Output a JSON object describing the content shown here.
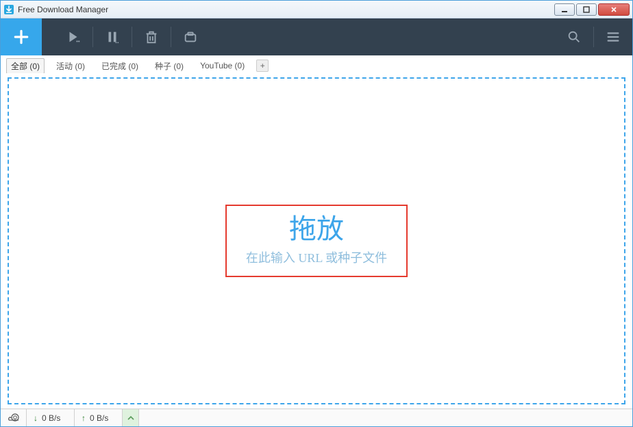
{
  "window": {
    "title": "Free Download Manager"
  },
  "tabs": {
    "items": [
      {
        "label": "全部 (0)",
        "active": true
      },
      {
        "label": "活动 (0)",
        "active": false
      },
      {
        "label": "已完成 (0)",
        "active": false
      },
      {
        "label": "种子 (0)",
        "active": false
      },
      {
        "label": "YouTube (0)",
        "active": false
      }
    ]
  },
  "drop": {
    "title": "拖放",
    "subtitle": "在此输入 URL 或种子文件"
  },
  "status": {
    "down_speed": "0 B/s",
    "up_speed": "0 B/s"
  }
}
